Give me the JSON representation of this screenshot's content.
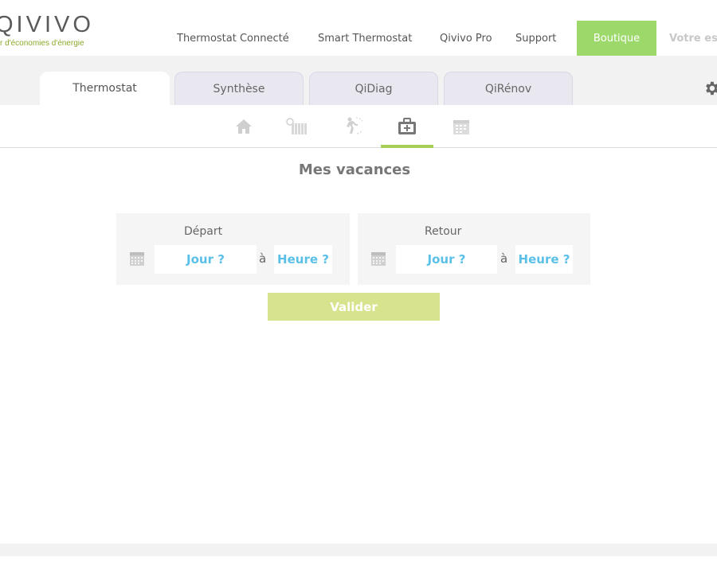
{
  "brand": {
    "logo": "QIVIVO",
    "tagline": "r d'économies d'énergie"
  },
  "nav": {
    "items": [
      "Thermostat Connecté",
      "Smart Thermostat",
      "Qivivo Pro",
      "Support"
    ],
    "boutique": "Boutique",
    "account": "Votre esp"
  },
  "tabs": {
    "items": [
      "Thermostat",
      "Synthèse",
      "QiDiag",
      "QiRénov"
    ],
    "active": "Thermostat"
  },
  "subnav": {
    "icons": [
      "home-icon",
      "radiator-icon",
      "away-person-icon",
      "suitcase-icon",
      "calendar-icon"
    ],
    "active": "suitcase-icon"
  },
  "vacation": {
    "title": "Mes vacances",
    "departure": {
      "label": "Départ",
      "day_placeholder": "Jour ?",
      "separator": "à",
      "hour_placeholder": "Heure ?"
    },
    "return": {
      "label": "Retour",
      "day_placeholder": "Jour ?",
      "separator": "à",
      "hour_placeholder": "Heure ?"
    },
    "submit": "Valider"
  },
  "colors": {
    "accent_green": "#9dd96a",
    "underline_green": "#a7cf55",
    "button_green": "#d8e38d",
    "field_blue": "#5bc0e8",
    "tagline_green": "#8aa92a"
  }
}
